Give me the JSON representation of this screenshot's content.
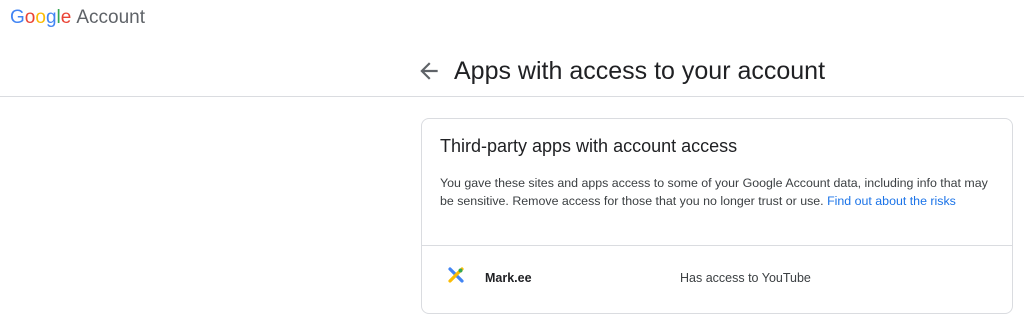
{
  "brand": {
    "letters": [
      {
        "char": "G",
        "color": "#4285F4"
      },
      {
        "char": "o",
        "color": "#EA4335"
      },
      {
        "char": "o",
        "color": "#FBBC05"
      },
      {
        "char": "g",
        "color": "#4285F4"
      },
      {
        "char": "l",
        "color": "#34A853"
      },
      {
        "char": "e",
        "color": "#EA4335"
      }
    ],
    "account_word": "Account"
  },
  "header": {
    "back_icon": "arrow-back-icon",
    "title": "Apps with access to your account"
  },
  "card": {
    "title": "Third-party apps with account access",
    "description": "You gave these sites and apps access to some of your Google Account data, including info that may be sensitive. Remove access for those that you no longer trust or use.",
    "link_label": "Find out about the risks",
    "apps": [
      {
        "icon": "markee-logo-icon",
        "name": "Mark.ee",
        "access": "Has access to YouTube"
      }
    ]
  },
  "colors": {
    "link": "#1a73e8",
    "divider": "#dadce0",
    "text_primary": "#202124",
    "text_secondary": "#3c4043"
  }
}
